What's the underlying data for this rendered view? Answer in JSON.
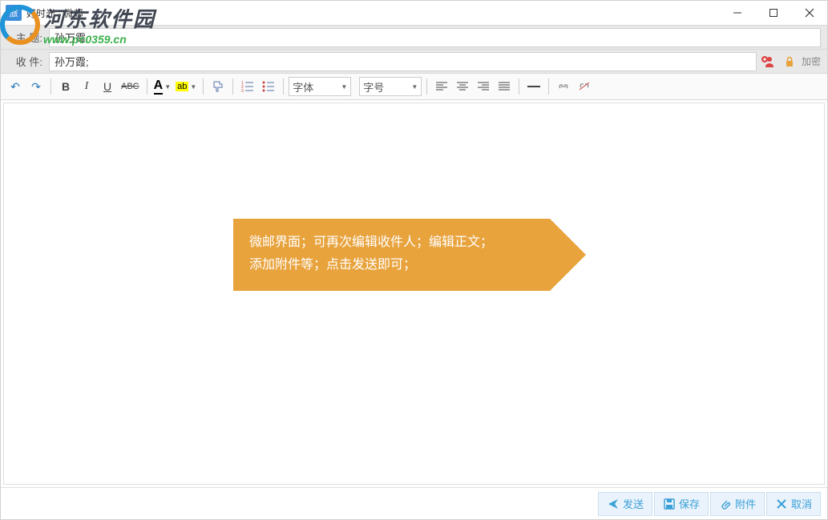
{
  "window": {
    "title": "好时光 - 微邮"
  },
  "subject": {
    "label": "主 题:",
    "value": "孙万霞"
  },
  "recipient": {
    "label": "收 件:",
    "value": "孙万霞;",
    "encrypt": "加密"
  },
  "toolbar": {
    "font_label": "字体",
    "size_label": "字号"
  },
  "callout": {
    "line1": "微邮界面；可再次编辑收件人；编辑正文；",
    "line2": "添加附件等；点击发送即可；"
  },
  "actions": {
    "send": "发送",
    "save": "保存",
    "attach": "附件",
    "cancel": "取消"
  },
  "watermark": {
    "cn": "河东软件园",
    "url": "www.pc0359.cn"
  }
}
